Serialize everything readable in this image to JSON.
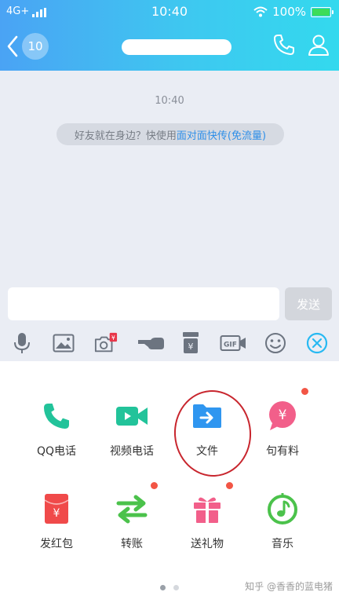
{
  "status_bar": {
    "network": "4G+",
    "time": "10:40",
    "battery": "100%"
  },
  "nav": {
    "unread_count": "10"
  },
  "chat": {
    "timestamp": "10:40",
    "tip_prefix": "好友就在身边？快使用",
    "tip_link": "面对面快传(免流量)"
  },
  "input": {
    "value": "",
    "placeholder": "",
    "send_label": "发送"
  },
  "toolbar": {
    "icons": [
      "mic-icon",
      "image-icon",
      "red-packet-camera-icon",
      "poke-icon",
      "wallet-icon",
      "gif-icon",
      "emoji-icon",
      "close-icon"
    ],
    "badge_text": "¥"
  },
  "apps": [
    {
      "label": "QQ电话"
    },
    {
      "label": "视频电话"
    },
    {
      "label": "文件"
    },
    {
      "label": "句有料",
      "glyph": "¥"
    },
    {
      "label": "发红包",
      "glyph": "¥"
    },
    {
      "label": "转账"
    },
    {
      "label": "送礼物"
    },
    {
      "label": "音乐"
    }
  ],
  "pager": {
    "current": 1,
    "total": 2
  },
  "watermark": "知乎 @香香的蓝电猪",
  "colors": {
    "header_gradient_start": "#4aa3f4",
    "header_gradient_end": "#33d9ee",
    "chat_bg": "#eaedf4",
    "link": "#2f8fe8",
    "accent_icon": "#27b9f2",
    "red_dot": "#f25545",
    "annotation_circle": "#c8262e"
  }
}
